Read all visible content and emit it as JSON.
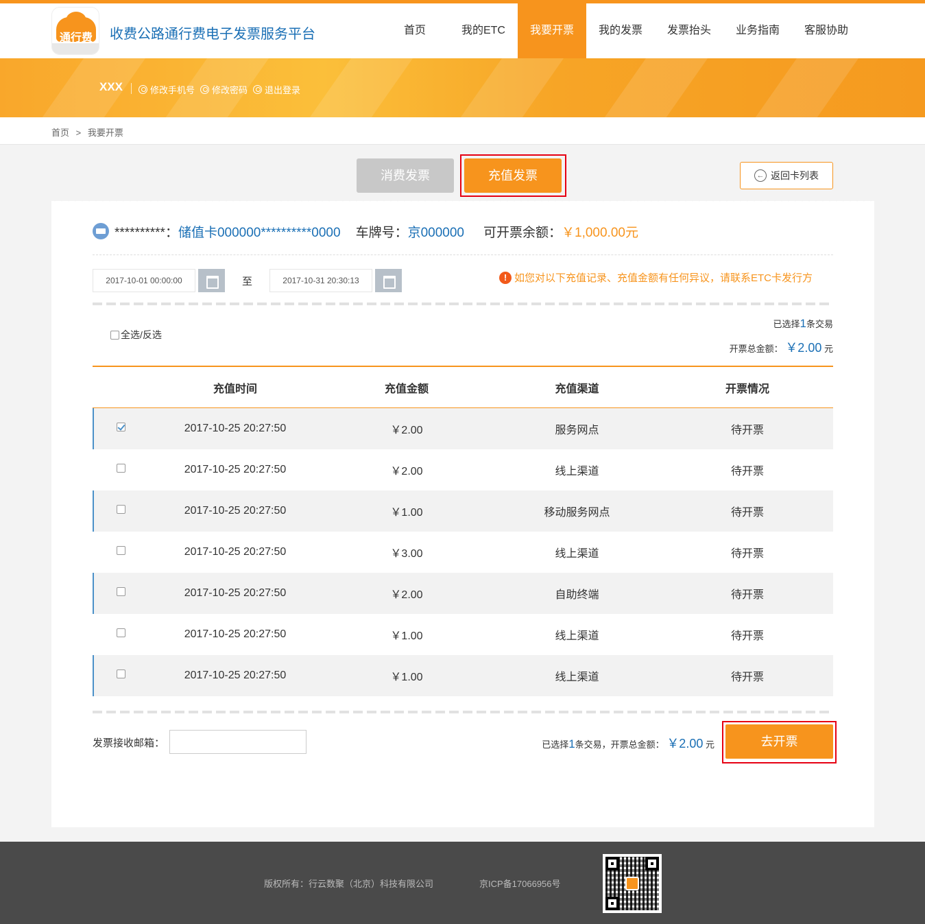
{
  "header": {
    "logo_text": "通行费",
    "site_title": "收费公路通行费电子发票服务平台",
    "nav": [
      {
        "label": "首页",
        "active": false
      },
      {
        "label": "我的ETC",
        "active": false
      },
      {
        "label": "我要开票",
        "active": true
      },
      {
        "label": "我的发票",
        "active": false
      },
      {
        "label": "发票抬头",
        "active": false
      },
      {
        "label": "业务指南",
        "active": false
      },
      {
        "label": "客服协助",
        "active": false
      }
    ],
    "accent_color": "#f7941d"
  },
  "user": {
    "name": "XXX",
    "links": [
      "修改手机号",
      "修改密码",
      "退出登录"
    ]
  },
  "breadcrumb": {
    "home": "首页",
    "separator": ">",
    "current": "我要开票"
  },
  "tabs": {
    "consume": "消费发票",
    "recharge": "充值发票",
    "back": "返回卡列表"
  },
  "card": {
    "masked_label": "**********：",
    "card_no": "储值卡000000**********0000",
    "plate_label": "车牌号：",
    "plate": "京000000",
    "balance_label": "可开票余额：",
    "balance": "￥1,000.00元"
  },
  "filter": {
    "start": "2017-10-01 00:00:00",
    "to": "至",
    "end": "2017-10-31 20:30:13",
    "notice": "如您对以下充值记录、充值金额有任何异议，请联系ETC卡发行方"
  },
  "selection": {
    "select_all": "全选/反选",
    "selected_prefix": "已选择",
    "selected_count": "1",
    "selected_suffix": "条交易",
    "total_label": "开票总金额：",
    "total_amount": "￥2.00",
    "total_unit": "元"
  },
  "table": {
    "headers": [
      "充值时间",
      "充值金额",
      "充值渠道",
      "开票情况"
    ],
    "rows": [
      {
        "time": "2017-10-25 20:27:50",
        "amount": "￥2.00",
        "channel": "服务网点",
        "status": "待开票",
        "checked": true
      },
      {
        "time": "2017-10-25 20:27:50",
        "amount": "￥2.00",
        "channel": "线上渠道",
        "status": "待开票",
        "checked": false
      },
      {
        "time": "2017-10-25 20:27:50",
        "amount": "￥1.00",
        "channel": "移动服务网点",
        "status": "待开票",
        "checked": false
      },
      {
        "time": "2017-10-25 20:27:50",
        "amount": "￥3.00",
        "channel": "线上渠道",
        "status": "待开票",
        "checked": false
      },
      {
        "time": "2017-10-25 20:27:50",
        "amount": "￥2.00",
        "channel": "自助终端",
        "status": "待开票",
        "checked": false
      },
      {
        "time": "2017-10-25 20:27:50",
        "amount": "￥1.00",
        "channel": "线上渠道",
        "status": "待开票",
        "checked": false
      },
      {
        "time": "2017-10-25 20:27:50",
        "amount": "￥1.00",
        "channel": "线上渠道",
        "status": "待开票",
        "checked": false
      }
    ]
  },
  "bottom": {
    "email_label": "发票接收邮箱：",
    "email_value": "",
    "summary_prefix": "已选择",
    "summary_count": "1",
    "summary_middle": "条交易，开票总金额：",
    "summary_amount": "￥2.00",
    "summary_unit": "元",
    "go_button": "去开票"
  },
  "footer": {
    "copyright": "版权所有：行云数聚（北京）科技有限公司",
    "icp": "京ICP备17066956号"
  }
}
